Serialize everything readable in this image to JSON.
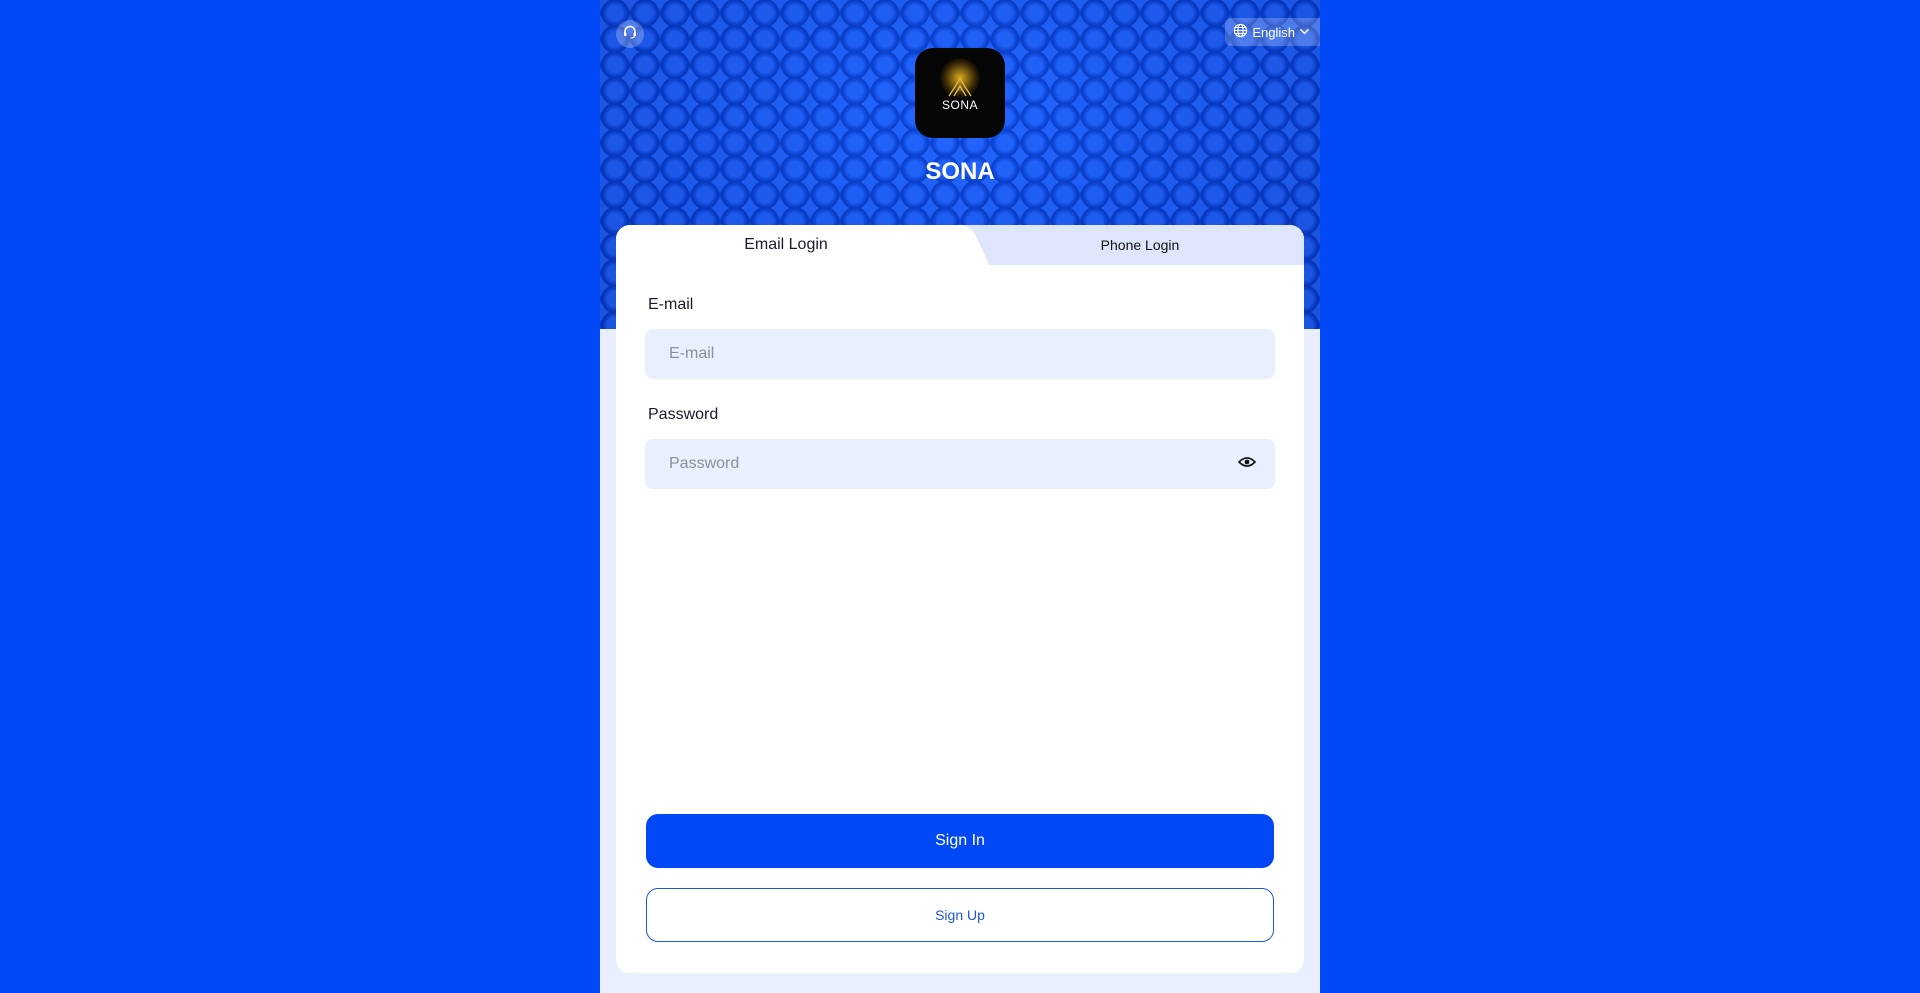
{
  "header": {
    "support_icon": "headset-icon",
    "language": {
      "icon": "globe-icon",
      "label": "English",
      "chevron_icon": "chevron-down-icon"
    },
    "logo": {
      "text": "SONA"
    },
    "app_name": "SONA"
  },
  "tabs": [
    {
      "label": "Email Login",
      "active": true
    },
    {
      "label": "Phone Login",
      "active": false
    }
  ],
  "form": {
    "email": {
      "label": "E-mail",
      "placeholder": "E-mail",
      "value": ""
    },
    "password": {
      "label": "Password",
      "placeholder": "Password",
      "value": "",
      "toggle_icon": "eye-icon"
    }
  },
  "actions": {
    "sign_in": "Sign In",
    "sign_up": "Sign Up"
  },
  "colors": {
    "brand": "#0047f5",
    "input_bg": "#e9effd",
    "page_bg": "#e9effc"
  }
}
